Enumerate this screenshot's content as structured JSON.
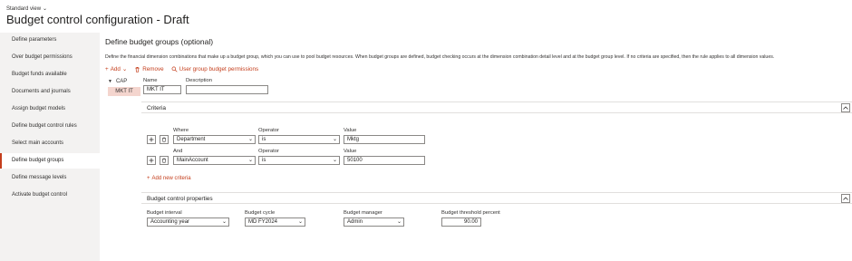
{
  "header": {
    "view_label": "Standard view",
    "title": "Budget control configuration - Draft"
  },
  "sidebar": {
    "items": [
      {
        "label": "Define parameters"
      },
      {
        "label": "Over budget permissions"
      },
      {
        "label": "Budget funds available"
      },
      {
        "label": "Documents and journals"
      },
      {
        "label": "Assign budget models"
      },
      {
        "label": "Define budget control rules"
      },
      {
        "label": "Select main accounts"
      },
      {
        "label": "Define budget groups"
      },
      {
        "label": "Define message levels"
      },
      {
        "label": "Activate budget control"
      }
    ],
    "active_index": 7
  },
  "main": {
    "title": "Define budget groups (optional)",
    "description": "Define the financial dimension combinations that make up a budget group, which you can use to pool budget resources. When budget groups are defined, budget checking occurs at the dimension combination detail level and at the budget group level. If no criteria are specified, then the rule applies to all dimension values.",
    "actions": {
      "add": "Add",
      "remove": "Remove",
      "permissions": "User group budget permissions"
    },
    "tree": {
      "root": "CAP",
      "child": "MKT IT"
    },
    "group": {
      "name_label": "Name",
      "name_value": "MKT IT",
      "description_label": "Description",
      "description_value": ""
    },
    "criteria": {
      "title": "Criteria",
      "rows": [
        {
          "where_label": "Where",
          "where_value": "Department",
          "operator_label": "Operator",
          "operator_value": "is",
          "value_label": "Value",
          "value": "Mktg"
        },
        {
          "where_label": "And",
          "where_value": "MainAccount",
          "operator_label": "Operator",
          "operator_value": "is",
          "value_label": "Value",
          "value": "50100"
        }
      ],
      "add_label": "Add new criteria"
    },
    "properties": {
      "title": "Budget control properties",
      "interval_label": "Budget interval",
      "interval_value": "Accounting year",
      "cycle_label": "Budget cycle",
      "cycle_value": "MD FY2024",
      "manager_label": "Budget manager",
      "manager_value": "Admin",
      "threshold_label": "Budget threshold percent",
      "threshold_value": "90.00"
    }
  },
  "colors": {
    "accent": "#c43e1c",
    "sidebar_bg": "#f3f2f1",
    "selected_row": "#f4d5ce"
  }
}
